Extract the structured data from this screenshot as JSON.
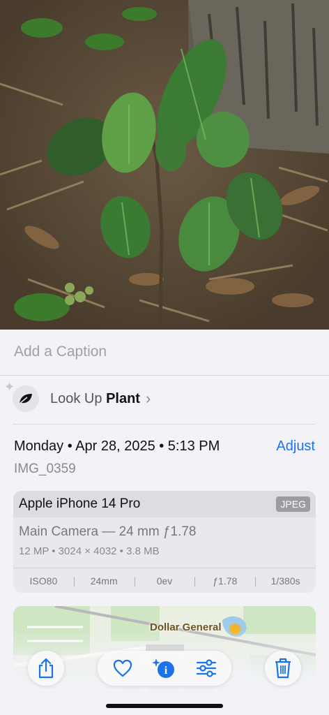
{
  "caption": {
    "placeholder": "Add a Caption"
  },
  "lookup": {
    "prefix": "Look Up",
    "subject": "Plant",
    "chevron": "›",
    "icon": "leaf-icon"
  },
  "date": {
    "text": "Monday • Apr 28, 2025 • 5:13 PM",
    "adjust_label": "Adjust"
  },
  "filename": "IMG_0359",
  "camera": {
    "device": "Apple iPhone 14 Pro",
    "format": "JPEG",
    "lens": "Main Camera — 24 mm ƒ1.78",
    "specs": "12 MP • 3024 × 4032 • 3.8 MB",
    "exif": [
      "ISO80",
      "24mm",
      "0ev",
      "ƒ1.78",
      "1/380s"
    ]
  },
  "map": {
    "place": "Dollar General"
  },
  "toolbar": {
    "share_icon": "share-icon",
    "favorite_icon": "heart-icon",
    "info_icon": "info-sparkle-icon",
    "adjust_icon": "sliders-icon",
    "delete_icon": "trash-icon"
  },
  "colors": {
    "accent": "#1a73e8",
    "background": "#f2f2f7"
  }
}
